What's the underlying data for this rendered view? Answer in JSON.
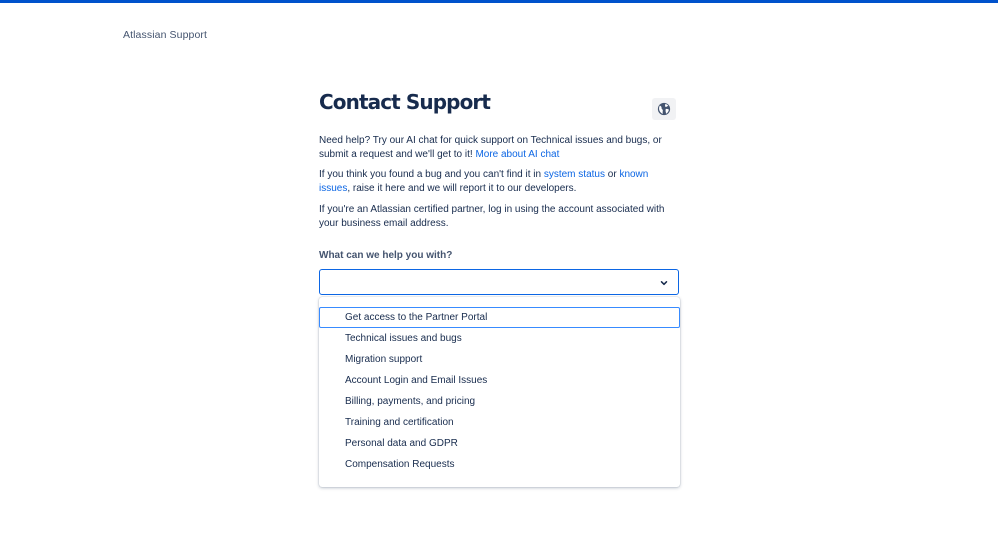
{
  "header": {
    "brand_label": "Atlassian Support"
  },
  "main": {
    "title": "Contact Support",
    "language_icon": "globe-icon",
    "intro": {
      "text": "Need help? Try our AI chat for quick support on Technical issues and bugs, or submit a request and we'll get to it! ",
      "link": "More about AI chat"
    },
    "bug_report": {
      "text_1": "If you think you found a bug and you can't find it in ",
      "link_status": "system status",
      "text_2": " or ",
      "link_issues": "known issues",
      "text_3": ", raise it here and we will report it to our developers."
    },
    "partner": {
      "text": "If you're an Atlassian certified partner, log in using the account associated with your business email address."
    }
  },
  "form": {
    "question_label": "What can we help you with?",
    "selected_value": "",
    "chevron_icon": "chevron-down-icon",
    "options": [
      "Get access to the Partner Portal",
      "Technical issues and bugs",
      "Migration support",
      "Account Login and Email Issues",
      "Billing, payments, and pricing",
      "Training and certification",
      "Personal data and GDPR",
      "Compensation Requests"
    ],
    "focused_option_index": 0
  },
  "colors": {
    "accent": "#0052cc",
    "link": "#0c66e4",
    "focus_ring": "#388bff",
    "text": "#172b4d",
    "subtle_text": "#44546f"
  }
}
